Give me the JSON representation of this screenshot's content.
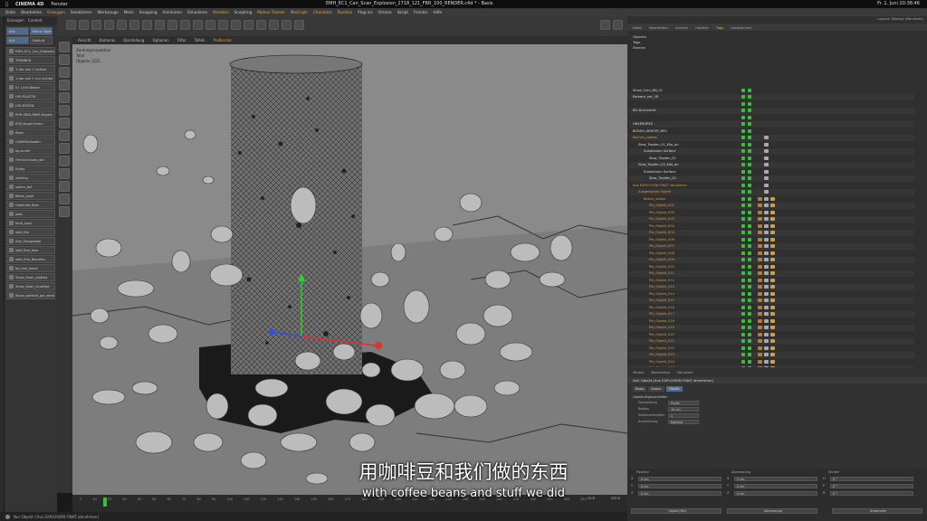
{
  "mac_bar": {
    "app": "CINEMA 4D",
    "menu_window": "Fenster",
    "doc_title": "EMH_EC1_Can_Scan_Explosion_2718_121_FBR_100_RENDER.c4d * - Basis",
    "datetime": "Fr. 1. Juni 20:38:46"
  },
  "c4d_menu": [
    "Datei",
    "Bearbeiten",
    "Erzeugen",
    "Selektieren",
    "Werkzeuge",
    "Mesh",
    "Snapping",
    "Animieren",
    "Simulieren",
    "Rendern",
    "Sculpting",
    "Motion Tracker",
    "MoGraph",
    "Charakter",
    "Pipeline",
    "Plug-ins",
    "Octane",
    "Skript",
    "Fenster",
    "Hilfe"
  ],
  "c4d_menu_highlight": [
    "Erzeugen",
    "Rendern",
    "Motion Tracker",
    "MoGraph",
    "Charakter",
    "Pipeline"
  ],
  "left_panel": {
    "tabs": [
      "Erzeugen",
      "Content"
    ],
    "buttons": [
      "Alle",
      "Keine Objekte",
      "Auf",
      "Default"
    ],
    "rows": [
      "EMH_EC1_Can_Explosion_Beans",
      "TRENNEN",
      "1 der voll + Lichter",
      "1 der voll + nur Lichter",
      "01 Licht Boden",
      "HIG-PLASTIK",
      "HIG-ROSEN",
      "EHR-SKIN-ANIM-Kugeln",
      "EHD-Kugel Intern",
      "Bean",
      "CAMERA-Boden",
      "bg-ornell",
      "Ohnlicht boss_ale",
      "Entity",
      "nothing",
      "sanim_bel",
      "Rohm_tope",
      "Gebaude_Rest",
      "Jade",
      "fault_tope",
      "stall_flat",
      "Abd_Dangeable",
      "stall_fine_bow",
      "stall_fine_Beinetts",
      "bd_fine_items",
      "Show_Hash_platted",
      "Show_Hash_Scrafted",
      "Show_particel_ple_zelekte"
    ]
  },
  "viewport": {
    "menu": [
      "Ansicht",
      "Kameras",
      "Darstellung",
      "Optionen",
      "Filter",
      "Tafeln",
      "ProRender"
    ],
    "label": "Zentralperspektive",
    "info_1": "Total",
    "info_2": "Objekte",
    "info_3": "1221"
  },
  "timeline": {
    "ticks": [
      "0",
      "10",
      "20",
      "30",
      "40",
      "50",
      "60",
      "70",
      "80",
      "90",
      "100",
      "110",
      "120",
      "130",
      "140",
      "150",
      "160",
      "170",
      "180",
      "190",
      "200",
      "210",
      "220",
      "230",
      "240",
      "250",
      "260",
      "270",
      "280",
      "290",
      "300",
      "310"
    ],
    "current": "20 B",
    "end": "325 B"
  },
  "status_bar": "Nur Objekt: [Aus EXPLOSION FINAT abnehmen]",
  "right_panel": {
    "layout": "Layout: Startup (Benutzer)",
    "tabs": [
      "Datei",
      "Bearbeiten",
      "Ansicht",
      "Objekte",
      "Tags",
      "Lesezeichen"
    ],
    "active_tab": "Tags",
    "filter_rows": [
      "Objekte",
      "Tags",
      "Ebenen"
    ],
    "objects": [
      {
        "name": "Show_Cam_BN_01",
        "indent": 0,
        "color": "#ddd"
      },
      {
        "name": "Kamera_vor_1B",
        "indent": 0,
        "color": "#ddd"
      },
      {
        "name": "",
        "indent": 0,
        "color": "#ddd"
      },
      {
        "name": "BG-Durchsicht",
        "indent": 0,
        "color": "#ddd"
      },
      {
        "name": "",
        "indent": 0,
        "color": "#ddd"
      },
      {
        "name": "UNSERGRES",
        "indent": 0,
        "color": "#ddd"
      },
      {
        "name": "BODEN_KRATER_NEU",
        "indent": 0,
        "color": "#ddd"
      },
      {
        "name": "Kochen_Leeres",
        "indent": 0,
        "color": "#e09a3a"
      },
      {
        "name": "Slow_Tropfen_01_Kilo_an",
        "indent": 1,
        "color": "#ddd"
      },
      {
        "name": "Subdivision Surface",
        "indent": 2,
        "color": "#ddd"
      },
      {
        "name": "Slow_Tropfen_01",
        "indent": 3,
        "color": "#ddd"
      },
      {
        "name": "Slow_Tropfen_02_Kilo_an",
        "indent": 1,
        "color": "#ddd"
      },
      {
        "name": "Subdivision Surface",
        "indent": 2,
        "color": "#ddd"
      },
      {
        "name": "Slow_Tropfen_02",
        "indent": 3,
        "color": "#ddd"
      },
      {
        "name": "Aus EXPLOSION FINAT abnehmen",
        "indent": 0,
        "color": "#e09a3a"
      },
      {
        "name": "Ausgewahlte Objekt",
        "indent": 1,
        "color": "#e09a3a"
      },
      {
        "name": "Bohne_Spitze",
        "indent": 2,
        "color": "#e09a3a"
      },
      {
        "name": "Pfo_Objekt_001",
        "indent": 3,
        "color": "#e09a3a"
      },
      {
        "name": "Pfo_Objekt_002",
        "indent": 3,
        "color": "#e09a3a"
      },
      {
        "name": "Pfo_Objekt_003",
        "indent": 3,
        "color": "#e09a3a"
      },
      {
        "name": "Pfo_Objekt_004",
        "indent": 3,
        "color": "#e09a3a"
      },
      {
        "name": "Pfo_Objekt_005",
        "indent": 3,
        "color": "#e09a3a"
      },
      {
        "name": "Pfo_Objekt_006",
        "indent": 3,
        "color": "#e09a3a"
      },
      {
        "name": "Pfo_Objekt_007",
        "indent": 3,
        "color": "#e09a3a"
      },
      {
        "name": "Pfo_Objekt_008",
        "indent": 3,
        "color": "#e09a3a"
      },
      {
        "name": "Pfo_Objekt_009",
        "indent": 3,
        "color": "#e09a3a"
      },
      {
        "name": "Pfo_Objekt_010",
        "indent": 3,
        "color": "#e09a3a"
      },
      {
        "name": "Pfo_Objekt_011",
        "indent": 3,
        "color": "#e09a3a"
      },
      {
        "name": "Pfo_Objekt_012",
        "indent": 3,
        "color": "#e09a3a"
      },
      {
        "name": "Pfo_Objekt_013",
        "indent": 3,
        "color": "#e09a3a"
      },
      {
        "name": "Pfo_Objekt_014",
        "indent": 3,
        "color": "#e09a3a"
      },
      {
        "name": "Pfo_Objekt_015",
        "indent": 3,
        "color": "#e09a3a"
      },
      {
        "name": "Pfo_Objekt_016",
        "indent": 3,
        "color": "#e09a3a"
      },
      {
        "name": "Pfo_Objekt_017",
        "indent": 3,
        "color": "#e09a3a"
      },
      {
        "name": "Pfo_Objekt_018",
        "indent": 3,
        "color": "#e09a3a"
      },
      {
        "name": "Pfo_Objekt_019",
        "indent": 3,
        "color": "#e09a3a"
      },
      {
        "name": "Pfo_Objekt_020",
        "indent": 3,
        "color": "#e09a3a"
      },
      {
        "name": "Pfo_Objekt_021",
        "indent": 3,
        "color": "#e09a3a"
      },
      {
        "name": "Pfo_Objekt_022",
        "indent": 3,
        "color": "#e09a3a"
      },
      {
        "name": "Pfo_Objekt_023",
        "indent": 3,
        "color": "#e09a3a"
      },
      {
        "name": "Pfo_Objekt_024",
        "indent": 3,
        "color": "#e09a3a"
      },
      {
        "name": "Pfo_Objekt_025",
        "indent": 3,
        "color": "#e09a3a"
      },
      {
        "name": "Pfo_Objekt_026",
        "indent": 3,
        "color": "#e09a3a"
      }
    ],
    "attr_tabs": [
      "Modus",
      "Bearbeiten",
      "Benutzer"
    ],
    "attr_title": "Null-Objekt [Aus EXPLOSION FINAT abnehmen]",
    "attr_subtabs": [
      "Basis",
      "Koord.",
      "Objekt"
    ],
    "attr_section": "Objekt-Eigenschaften",
    "attr_fields": [
      {
        "label": "Darstellung",
        "value": "Punkt"
      },
      {
        "label": "Radius",
        "value": "10 cm"
      },
      {
        "label": "Seitenverhaltnis",
        "value": "1"
      },
      {
        "label": "Ausrichtung",
        "value": "Kamera"
      }
    ],
    "coord_headers": [
      "Position",
      "Abmessung",
      "Winkel"
    ],
    "coord_rows": [
      [
        "X",
        "0 cm",
        "X",
        "0 cm",
        "H",
        "0 °"
      ],
      [
        "Y",
        "0 cm",
        "Y",
        "0 cm",
        "P",
        "0 °"
      ],
      [
        "Z",
        "0 cm",
        "Z",
        "0 cm",
        "B",
        "0 °"
      ]
    ],
    "coord_buttons": [
      "Objekt (Rel)",
      "Abmessung",
      "Anwenden"
    ]
  },
  "subtitle": {
    "zh": "用咖啡豆和我们做的东西",
    "en": "with coffee beans and stuff we did"
  },
  "colors": {
    "accent": "#e09a3a",
    "visible_green": "#3bbf3b",
    "viewport_bg": "#808080"
  }
}
